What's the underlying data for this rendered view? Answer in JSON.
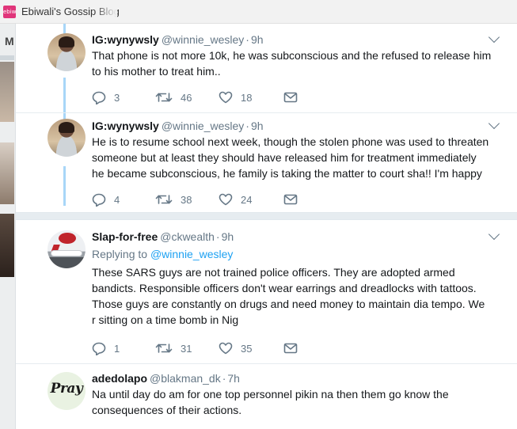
{
  "browser": {
    "tab_favicon_text": "ebiw",
    "tab_title": "Ebiwali's Gossip Blog"
  },
  "background_page": {
    "partial_letter": "M"
  },
  "tweets": [
    {
      "name": "IG:wynywsly",
      "handle": "@winnie_wesley",
      "time": "9h",
      "avatar_icon": "user-avatar-woman",
      "text_lines": [
        "That phone is not more 10k, he was subconscious and the refused to release him",
        "to his mother to treat him.."
      ],
      "replies": "3",
      "retweets": "46",
      "likes": "18"
    },
    {
      "name": "IG:wynywsly",
      "handle": "@winnie_wesley",
      "time": "9h",
      "avatar_icon": "user-avatar-woman",
      "text_lines": [
        "He is to resume school next week, though the stolen phone was used to threaten",
        "someone but at least they should have released him for treatment immediately",
        "he became subconscious, he family is taking the matter to court sha!! I'm happy"
      ],
      "replies": "4",
      "retweets": "38",
      "likes": "24"
    },
    {
      "name": "Slap-for-free",
      "handle": "@ckwealth",
      "time": "9h",
      "avatar_icon": "user-avatar-airplane",
      "replying_prefix": "Replying to",
      "replying_mention": "@winnie_wesley",
      "text_lines": [
        "These SARS guys are not trained police officers. They are adopted armed",
        "bandicts. Responsible officers don't wear earrings and dreadlocks with tattoos.",
        "Those guys are constantly on drugs and need money to maintain dia tempo. We",
        "r sitting on a time bomb in Nig"
      ],
      "replies": "1",
      "retweets": "31",
      "likes": "35"
    },
    {
      "name": "adedolapo",
      "handle": "@blakman_dk",
      "time": "7h",
      "avatar_icon": "user-avatar-pray",
      "avatar_text": "Pray",
      "text_lines": [
        "Na until day do am for one top personnel pikin na then them go know the",
        "consequences of their actions."
      ]
    }
  ],
  "separator": "·",
  "colors": {
    "link": "#1da1f2",
    "muted": "#657786",
    "text": "#14171a",
    "thread_line": "#a8d6f8"
  }
}
